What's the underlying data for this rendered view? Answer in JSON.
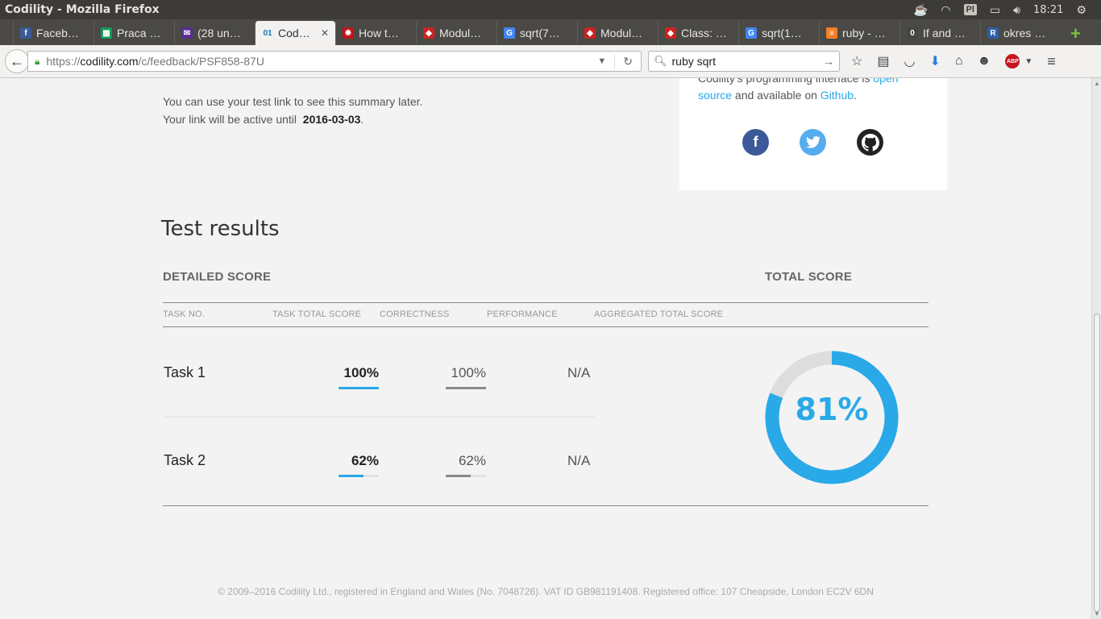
{
  "window": {
    "title": "Codility - Mozilla Firefox"
  },
  "tray": {
    "keyboard": "Pl",
    "time": "18:21"
  },
  "tabs": [
    {
      "label": "Faceb…",
      "icon": "facebook-icon",
      "color": "#3b5998",
      "glyph": "f"
    },
    {
      "label": "Praca …",
      "icon": "sheets-icon",
      "color": "#0f9d58",
      "glyph": "▦"
    },
    {
      "label": "(28 un…",
      "icon": "mail-icon",
      "color": "#5a2d91",
      "glyph": "✉"
    },
    {
      "label": "Cod…",
      "icon": "codility-icon",
      "color": "#1a77b8",
      "glyph": "01",
      "active": true
    },
    {
      "label": "How t…",
      "icon": "bug-icon",
      "color": "#c0141a",
      "glyph": "✹"
    },
    {
      "label": "Modul…",
      "icon": "ruby-icon",
      "color": "#cc2222",
      "glyph": "◆"
    },
    {
      "label": "sqrt(7…",
      "icon": "google-icon",
      "color": "#4285f4",
      "glyph": "G"
    },
    {
      "label": "Modul…",
      "icon": "ruby-icon",
      "color": "#cc2222",
      "glyph": "◆"
    },
    {
      "label": "Class: …",
      "icon": "ruby-icon",
      "color": "#cc2222",
      "glyph": "◆"
    },
    {
      "label": "sqrt(1…",
      "icon": "google-icon",
      "color": "#4285f4",
      "glyph": "G"
    },
    {
      "label": "ruby - …",
      "icon": "stackoverflow-icon",
      "color": "#f48024",
      "glyph": "≡"
    },
    {
      "label": "If and …",
      "icon": "page-icon",
      "color": "#444444",
      "glyph": "0"
    },
    {
      "label": "okres …",
      "icon": "r-icon",
      "color": "#2d5fa7",
      "glyph": "R"
    }
  ],
  "nav": {
    "url_prefix": "https://",
    "url_host": "codility.com",
    "url_path": "/c/feedback/PSF858-87U",
    "search_value": "ruby sqrt"
  },
  "info": {
    "line1": "You can use your test link to see this summary later.",
    "line2_prefix": "Your link will be active until",
    "active_until": "2016-03-03",
    "line2_suffix": "."
  },
  "card": {
    "text_before": "Codility's programming interface is",
    "link1": "open source",
    "text_mid": "and available on",
    "link2": "Github",
    "text_end": "."
  },
  "results": {
    "heading": "Test results",
    "detailed_heading": "DETAILED SCORE",
    "total_heading": "TOTAL SCORE",
    "columns": [
      "TASK NO.",
      "TASK TOTAL SCORE",
      "CORRECTNESS",
      "PERFORMANCE",
      "AGGREGATED TOTAL SCORE"
    ],
    "tasks": [
      {
        "name": "Task 1",
        "total": "100%",
        "total_frac": 1.0,
        "correctness": "100%",
        "correctness_frac": 1.0,
        "performance": "N/A"
      },
      {
        "name": "Task 2",
        "total": "62%",
        "total_frac": 0.62,
        "correctness": "62%",
        "correctness_frac": 0.62,
        "performance": "N/A"
      }
    ],
    "total_score": "81%",
    "total_score_frac": 0.81
  },
  "colors": {
    "accent": "#29a9e8",
    "gray_bar": "#8a8a8a",
    "track": "#dddddd"
  },
  "footer": "© 2009–2016 Codility Ltd., registered in England and Wales (No. 7048726). VAT ID GB981191408. Registered office: 107 Cheapside, London EC2V 6DN"
}
